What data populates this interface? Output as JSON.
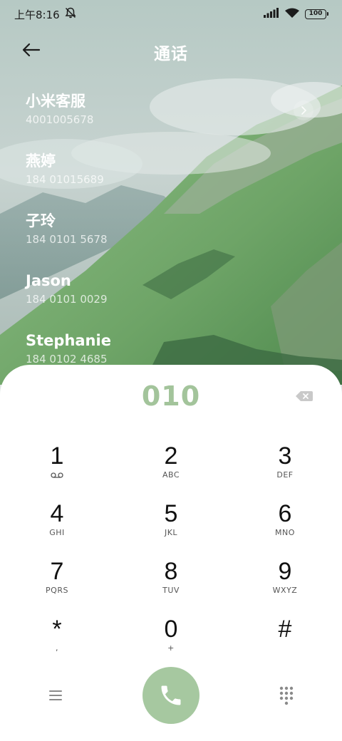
{
  "status_bar": {
    "time": "上午8:16",
    "icons": [
      "notification-muted-icon",
      "signal-icon",
      "wifi-icon",
      "battery-icon"
    ],
    "battery_level": "100"
  },
  "header": {
    "title": "通话",
    "back_icon": "arrow-left-icon"
  },
  "contacts": [
    {
      "name": "小米客服",
      "number": "4001005678"
    },
    {
      "name": "燕婷",
      "number": "184 01015689"
    },
    {
      "name": "子玲",
      "number": "184 0101 5678"
    },
    {
      "name": "Jason",
      "number": "184 0101 0029"
    },
    {
      "name": "Stephanie",
      "number": "184 0102 4685"
    }
  ],
  "dialer": {
    "input_value": "010",
    "accent_color": "#a6c8a0",
    "keys": [
      {
        "digit": "1",
        "letters": ""
      },
      {
        "digit": "2",
        "letters": "ABC"
      },
      {
        "digit": "3",
        "letters": "DEF"
      },
      {
        "digit": "4",
        "letters": "GHI"
      },
      {
        "digit": "5",
        "letters": "JKL"
      },
      {
        "digit": "6",
        "letters": "MNO"
      },
      {
        "digit": "7",
        "letters": "PQRS"
      },
      {
        "digit": "8",
        "letters": "TUV"
      },
      {
        "digit": "9",
        "letters": "WXYZ"
      },
      {
        "digit": "*",
        "letters": ","
      },
      {
        "digit": "0",
        "letters": "+"
      },
      {
        "digit": "#",
        "letters": ""
      }
    ]
  }
}
